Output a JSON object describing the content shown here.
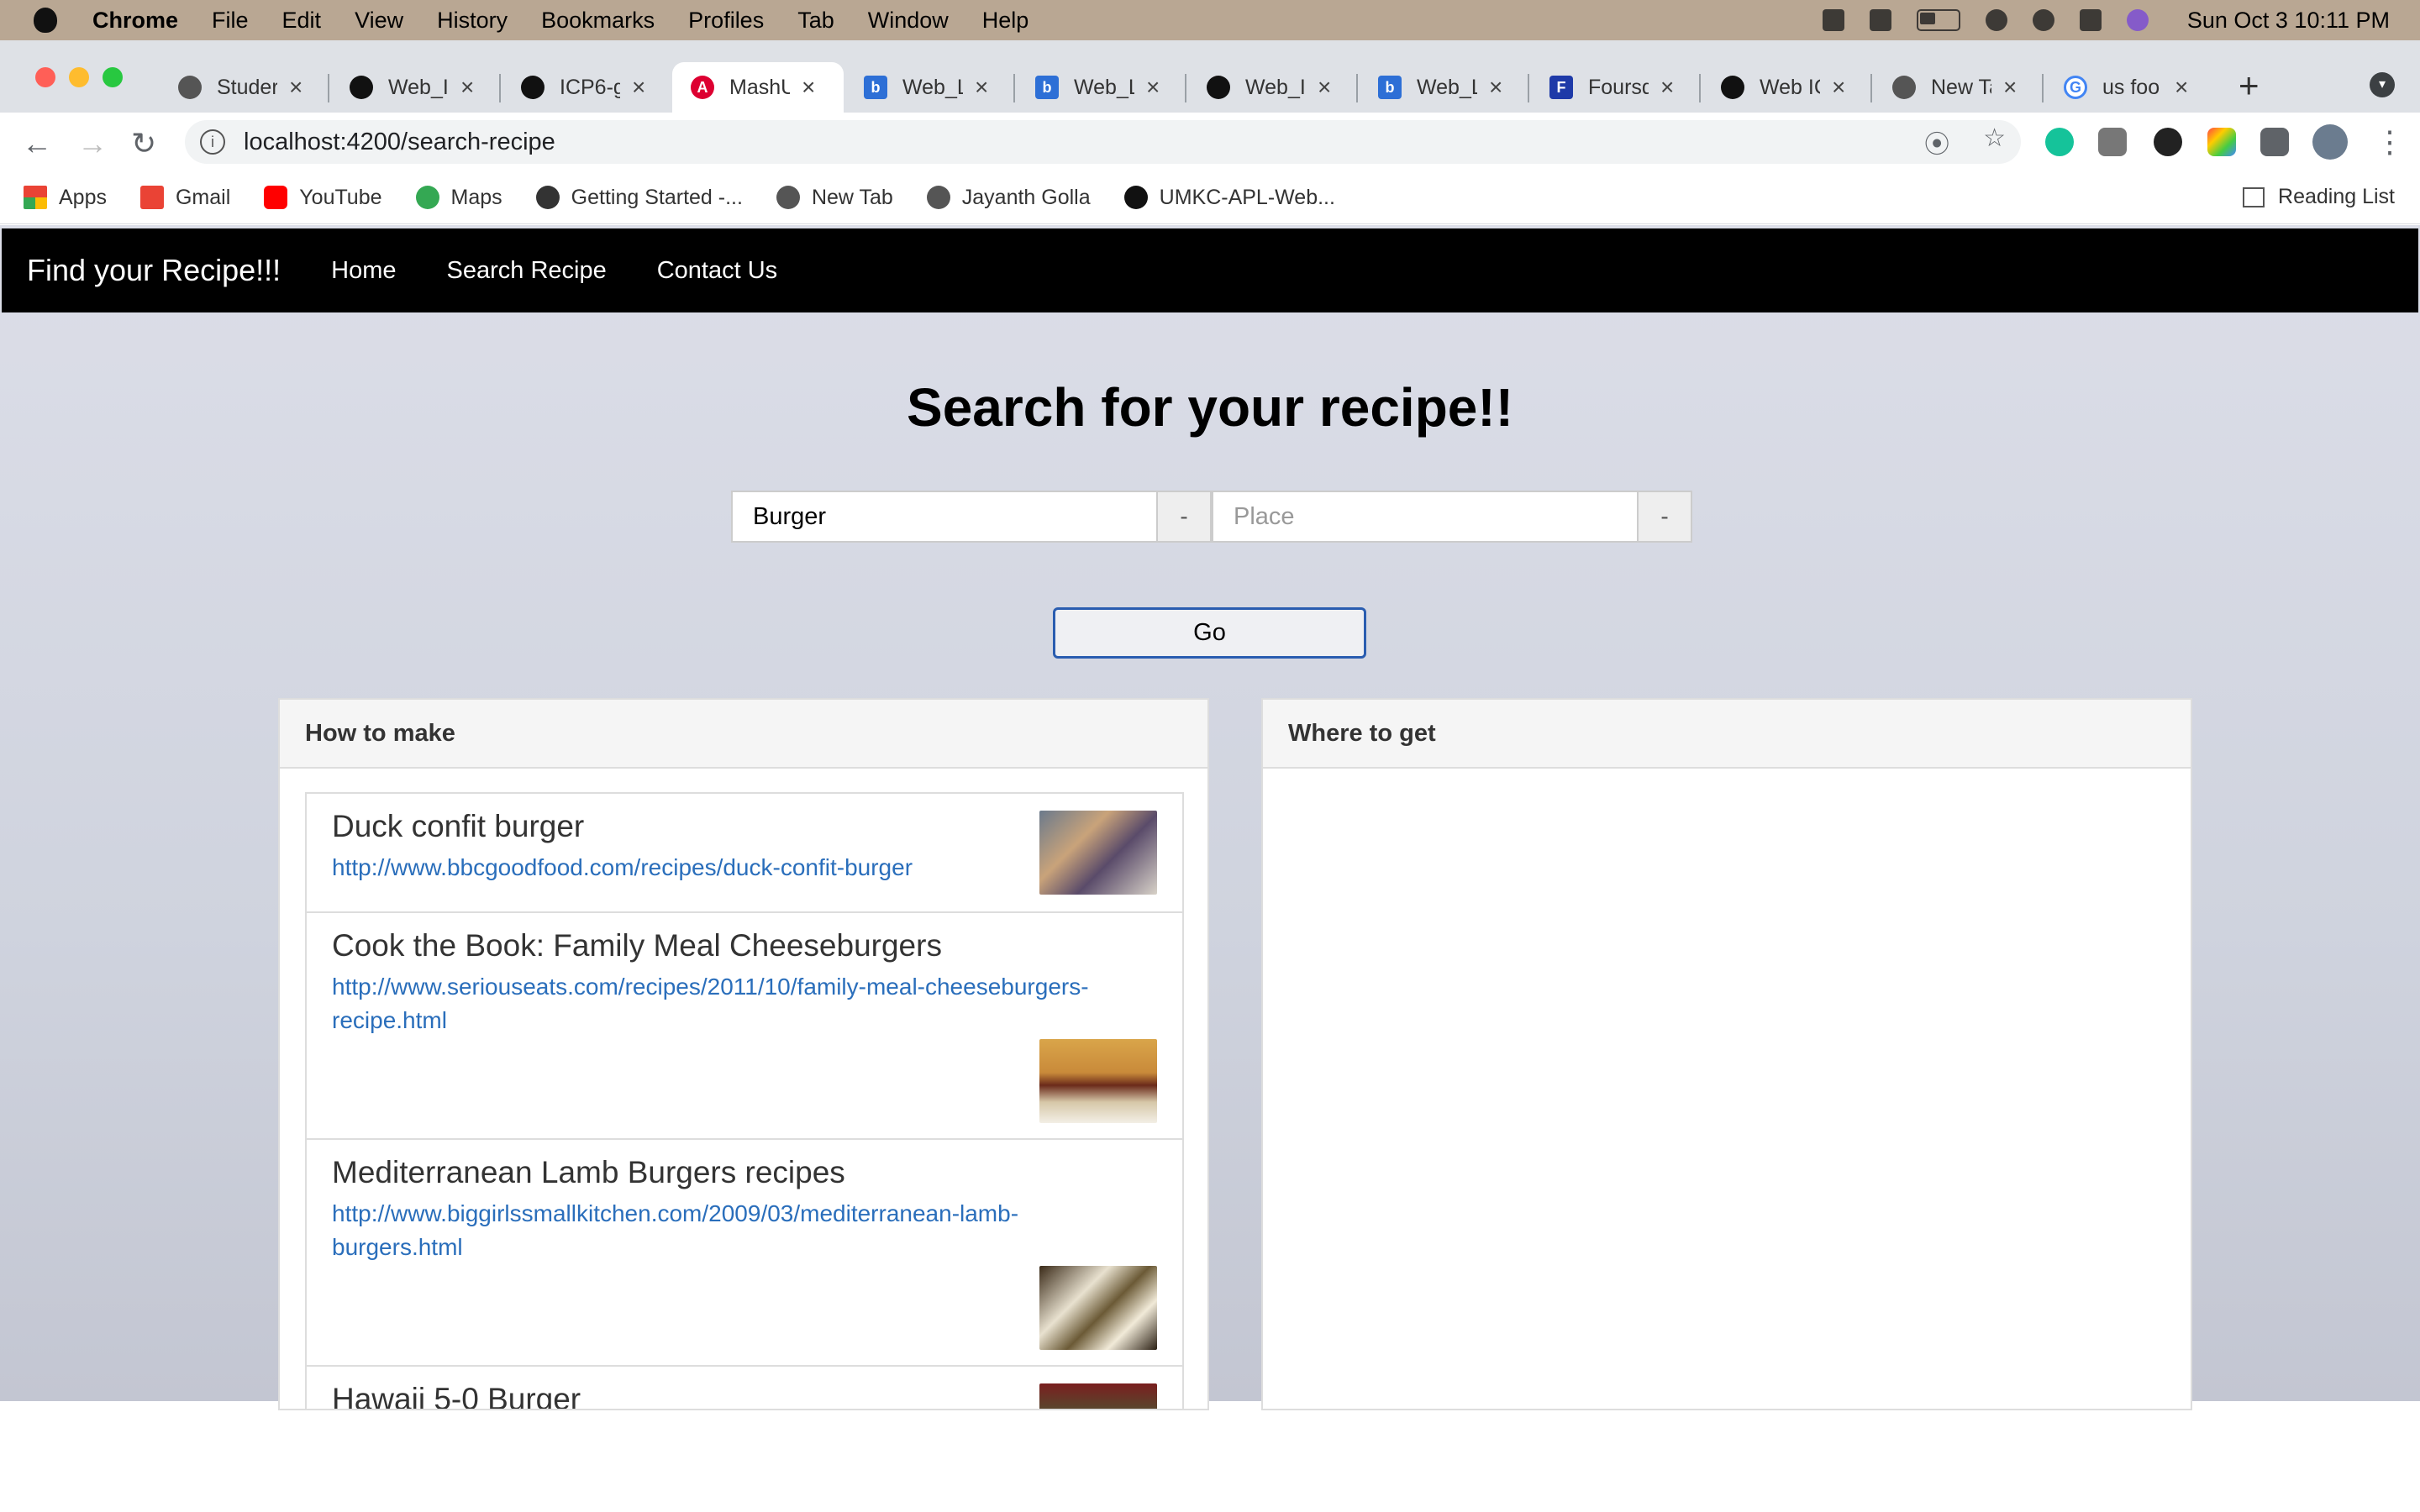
{
  "menubar": {
    "app": "Chrome",
    "items": [
      "File",
      "Edit",
      "View",
      "History",
      "Bookmarks",
      "Profiles",
      "Tab",
      "Window",
      "Help"
    ],
    "datetime": "Sun Oct 3  10:11 PM"
  },
  "tabs": [
    {
      "label": "Studer",
      "active": false
    },
    {
      "label": "Web_I",
      "active": false
    },
    {
      "label": "ICP6-g",
      "active": false
    },
    {
      "label": "MashU",
      "active": true
    },
    {
      "label": "Web_L",
      "active": false
    },
    {
      "label": "Web_L",
      "active": false
    },
    {
      "label": "Web_I",
      "active": false
    },
    {
      "label": "Web_L",
      "active": false
    },
    {
      "label": "Foursq",
      "active": false
    },
    {
      "label": "Web IC",
      "active": false
    },
    {
      "label": "New Ta",
      "active": false
    },
    {
      "label": "us foo",
      "active": false
    }
  ],
  "address_bar": {
    "url": "localhost:4200/search-recipe"
  },
  "bookmarks": [
    "Apps",
    "Gmail",
    "YouTube",
    "Maps",
    "Getting Started -...",
    "New Tab",
    "Jayanth Golla",
    "UMKC-APL-Web..."
  ],
  "reading_list": "Reading List",
  "app_nav": {
    "brand": "Find your Recipe!!!",
    "links": [
      "Home",
      "Search Recipe",
      "Contact Us"
    ]
  },
  "search": {
    "heading": "Search for your recipe!!",
    "recipe_value": "Burger",
    "recipe_addon": "-",
    "place_placeholder": "Place",
    "place_addon": "-",
    "go_label": "Go"
  },
  "how_to_make": {
    "header": "How to make",
    "items": [
      {
        "title": "Duck confit burger",
        "url": "http://www.bbcgoodfood.com/recipes/duck-confit-burger",
        "url_line2": ""
      },
      {
        "title": "Cook the Book: Family Meal Cheeseburgers",
        "url": "http://www.seriouseats.com/recipes/2011/10/family-meal-cheeseburgers-",
        "url_line2": "recipe.html"
      },
      {
        "title": "Mediterranean Lamb Burgers recipes",
        "url": "http://www.biggirlssmallkitchen.com/2009/03/mediterranean-lamb-",
        "url_line2": "burgers.html"
      },
      {
        "title": "Hawaii 5-0 Burger",
        "url": "",
        "url_line2": ""
      }
    ]
  },
  "where_to_get": {
    "header": "Where to get"
  }
}
